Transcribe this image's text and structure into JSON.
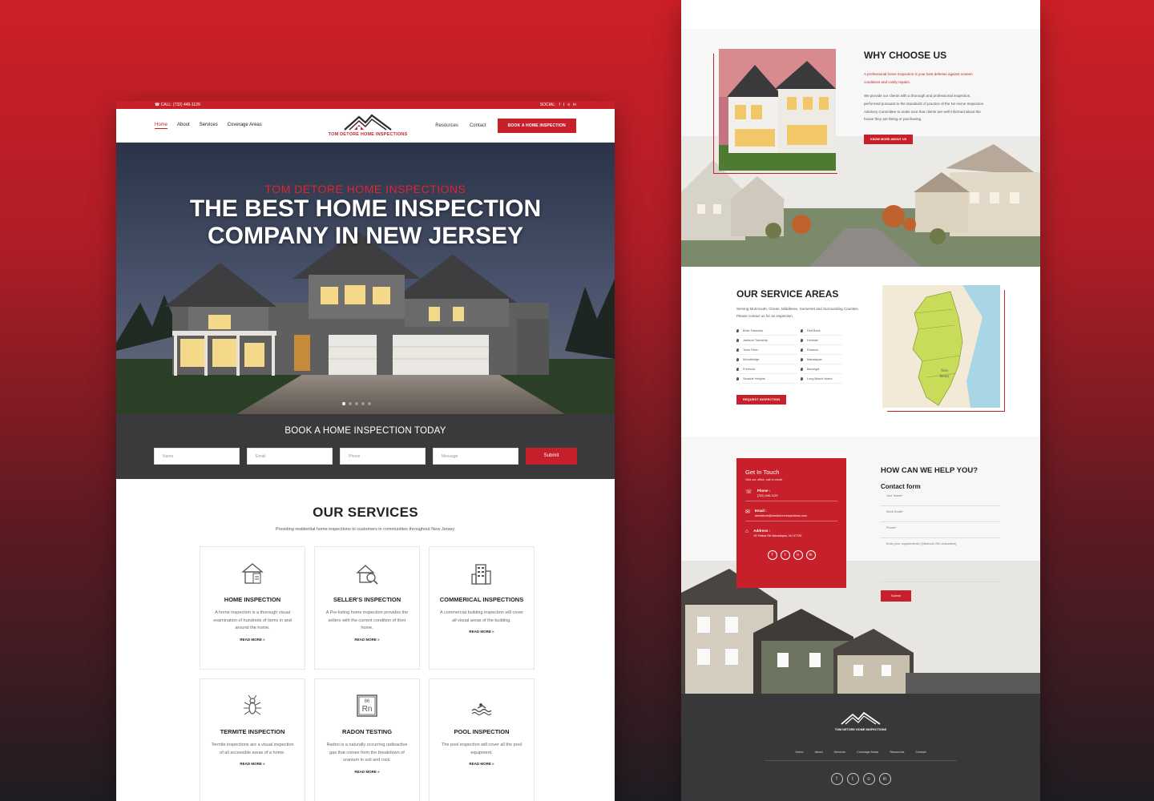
{
  "left": {
    "topbar": {
      "phone": "CALL: (732) 446-1129",
      "social_label": "SOCIAL:",
      "social_icons": [
        "f",
        "t",
        "o",
        "in"
      ]
    },
    "nav": {
      "links": [
        "Home",
        "About",
        "Services",
        "Coverage Areas"
      ],
      "right_links": [
        "Resources",
        "Contact"
      ],
      "cta": "BOOK A HOME INSPECTION",
      "logo_text": "TOM DETORE HOME INSPECTIONS"
    },
    "hero": {
      "eyebrow": "TOM DETORE HOME INSPECTIONS",
      "title_line1": "THE BEST HOME INSPECTION",
      "title_line2": "COMPANY IN NEW JERSEY"
    },
    "booking": {
      "title": "BOOK A HOME INSPECTION TODAY",
      "name": "Name",
      "email": "Email",
      "phone": "Phone",
      "message": "Message",
      "submit": "Submit"
    },
    "services": {
      "title": "OUR SERVICES",
      "subtitle": "Providing residential home inspections to customers in communities throughout New Jersey.",
      "read_more": "READ MORE »",
      "items": [
        {
          "icon": "home-inspection-icon",
          "title": "HOME INSPECTION",
          "desc": "A home inspection is a thorough visual examination of hundreds of items in and around the home."
        },
        {
          "icon": "magnifier-house-icon",
          "title": "SELLER'S INSPECTION",
          "desc": "A Pre-listing home inspection provides the sellers with the current condition of their home."
        },
        {
          "icon": "building-icon",
          "title": "COMMERICAL INSPECTIONS",
          "desc": "A commercial building inspection will cover all visual areas of the building."
        },
        {
          "icon": "termite-icon",
          "title": "TERMITE INSPECTION",
          "desc": "Termite inspections are a visual inspection of all accessible areas of a home."
        },
        {
          "icon": "radon-icon",
          "title": "RADON TESTING",
          "desc": "Radon is a naturally occurring radioactive gas that comes from the breakdown of uranium in soil and rock."
        },
        {
          "icon": "pool-icon",
          "title": "POOL INSPECTION",
          "desc": "The pool inspection will cover all the pool equipment."
        }
      ]
    }
  },
  "right": {
    "why": {
      "title": "WHY CHOOSE US",
      "red": "A professional home inspection is your best defense against unseen conditions and costly repairs.",
      "body": "We provide our clients with a thorough and professional inspection, performed pursuant to the standards of practice of the NJ Home Inspection Advisory Committee to make sure that clients are well informed about the house they are listing or purchasing.",
      "button": "KNOW MORE ABOUT US"
    },
    "areas": {
      "title": "OUR SERVICE AREAS",
      "desc": "Serving Monmouth, Ocean, Middlesex, Somerset and Surrounding Counties. Please contact us for an inspection.",
      "col1": [
        "Brick Township",
        "Jackson Township",
        "Toms River",
        "Woodbridge",
        "Freehold",
        "Seaside Heights"
      ],
      "col2": [
        "Red Bank",
        "Holmdel",
        "Rumson",
        "Manalapan",
        "Barnegat",
        "Long Beach Island"
      ],
      "button": "REQUEST INSPECTION",
      "map_labels": [
        "New",
        "Jersey"
      ]
    },
    "contact": {
      "title": "Get In Touch",
      "sub": "Visit our office, call or email.",
      "phone_label": "Phone :",
      "phone": "(732) 446-1129",
      "email_label": "Email :",
      "email": "tomdetore@tomdetoreinspections.com",
      "address_label": "Address :",
      "address": "15 Yellow Rd Manalapan, NJ 07726",
      "socials": [
        "f",
        "t",
        "o",
        "in"
      ]
    },
    "help": {
      "title": "HOW CAN WE HELP YOU?",
      "form_title": "Contact form",
      "name": "Your Name*",
      "email": "Work Email*",
      "phone": "Phone*",
      "req": "Enter your requirements* (Minimum 250 characters)",
      "submit": "Submit"
    },
    "footer": {
      "logo_text": "TOM DETORE HOME INSPECTIONS",
      "links": [
        "Home",
        "About",
        "Services",
        "Coverage Areas",
        "Resources",
        "Contact"
      ],
      "socials": [
        "f",
        "t",
        "o",
        "in"
      ]
    }
  },
  "colors": {
    "brand_red": "#c8202a",
    "dark": "#3a3a3c"
  }
}
